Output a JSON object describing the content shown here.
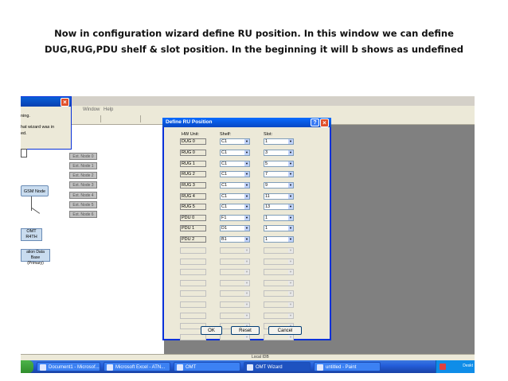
{
  "caption": {
    "line1": "Now in configuration wizard define RU position. In this window we can define",
    "line2": "DUG,RUG,PDU shelf & slot position. In the beginning  it  will b shows as undefined"
  },
  "menu": {
    "items": [
      "Window",
      "Help"
    ]
  },
  "left_window": {
    "text_lines": [
      "ning.",
      "hat wizard was in",
      "ed."
    ]
  },
  "canvas": {
    "ext_nodes": [
      "Ext. Node 0",
      "Ext. Node 1",
      "Ext. Node 2",
      "Ext. Node 3",
      "Ext. Node 4",
      "Ext. Node 5",
      "Ext. Node 6"
    ],
    "gsm_node": "GSM Node",
    "omt": {
      "line1": "OMT",
      "line2": "R4TH"
    },
    "database": {
      "line1": "ation Data Base",
      "line2": "(Primary)"
    }
  },
  "dialog": {
    "title": "Define RU Position",
    "headers": {
      "hw": "HW Unit:",
      "shelf": "Shelf:",
      "slot": "Slot:"
    },
    "rows": [
      {
        "hw": "DUG 0",
        "shelf": "C1",
        "slot": "1"
      },
      {
        "hw": "RUG 0",
        "shelf": "C1",
        "slot": "3"
      },
      {
        "hw": "RUG 1",
        "shelf": "C1",
        "slot": "5"
      },
      {
        "hw": "RUG 2",
        "shelf": "C1",
        "slot": "7"
      },
      {
        "hw": "RUG 3",
        "shelf": "C1",
        "slot": "9"
      },
      {
        "hw": "RUG 4",
        "shelf": "C1",
        "slot": "11"
      },
      {
        "hw": "RUG 5",
        "shelf": "C1",
        "slot": "13"
      },
      {
        "hw": "PDU 0",
        "shelf": "F1",
        "slot": "1"
      },
      {
        "hw": "PDU 1",
        "shelf": "D1",
        "slot": "1"
      },
      {
        "hw": "PDU 2",
        "shelf": "B1",
        "slot": "1"
      }
    ],
    "empty_rows": 9,
    "buttons": {
      "ok": "OK",
      "reset": "Reset",
      "cancel": "Cancel"
    }
  },
  "status_bar": {
    "text": "Local IDB"
  },
  "taskbar": {
    "tasks": [
      "Document1 - Microsof...",
      "Microsoft Excel - ATN...",
      "OMT",
      "OMT Wizard",
      "untitled - Paint"
    ],
    "tray_text": "Deskt"
  },
  "colors": {
    "titlebar": "#0847c4",
    "taskbar": "#245edb",
    "dialog_bg": "#ece9d8"
  }
}
